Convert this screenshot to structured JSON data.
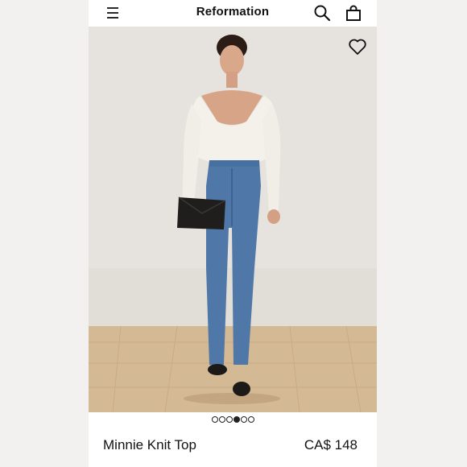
{
  "header": {
    "brand": "Reformation",
    "icons": [
      "menu-icon",
      "search-icon",
      "shopping-bag-icon"
    ]
  },
  "gallery": {
    "image_count": 6,
    "active_index": 3,
    "favorite_icon": "heart-icon"
  },
  "product": {
    "name": "Minnie Knit Top",
    "price": "CA$ 148"
  },
  "colors": {
    "text": "#111111",
    "wall": "#e7e4df",
    "floor": "#d6bc9c",
    "denim": "#4f78a8",
    "top": "#f4f1ea"
  }
}
